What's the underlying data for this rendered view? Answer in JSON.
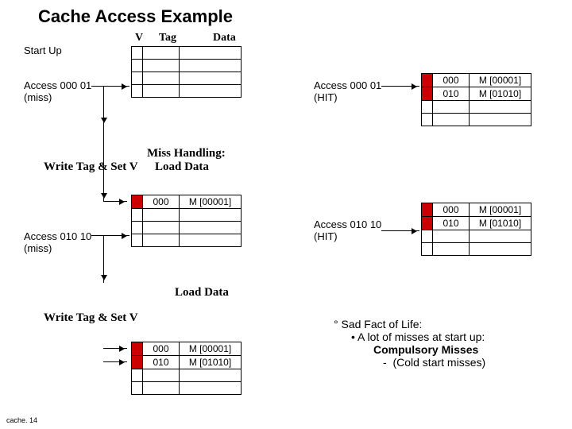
{
  "title": "Cache Access Example",
  "headers": {
    "v": "V",
    "tag": "Tag",
    "data": "Data"
  },
  "labels": {
    "startup": "Start Up",
    "access1": "Access 000 01",
    "miss": "(miss)",
    "hit": "(HIT)",
    "misshandling": "Miss Handling:",
    "writetag": "Write Tag & Set V",
    "loaddata": "Load Data",
    "access2": "Access 010 10"
  },
  "rows": {
    "r1": {
      "tag": "000",
      "data": "M [00001]"
    },
    "r2": {
      "tag": "010",
      "data": "M [01010]"
    }
  },
  "facts": {
    "h1": "Sad Fact of Life:",
    "l1": "A lot of misses at start up:",
    "l2": "Compulsory Misses",
    "l3": "(Cold start misses)"
  },
  "footer": "cache. 14",
  "chart_data": {
    "type": "table",
    "description": "Sequence of cache states for a direct-mapped cache with 4 lines, columns V (valid bit), Tag, Data.",
    "columns": [
      "V",
      "Tag",
      "Data"
    ],
    "steps": [
      {
        "label": "Start Up",
        "lines": [
          {
            "v": 0
          },
          {
            "v": 0
          },
          {
            "v": 0
          },
          {
            "v": 0
          }
        ]
      },
      {
        "label": "Access 000 01 (miss)",
        "action": "miss"
      },
      {
        "label": "Miss Handling: Write Tag & Set V / Load Data",
        "lines": [
          {
            "v": 1,
            "tag": "000",
            "data": "M [00001]"
          },
          {
            "v": 0
          },
          {
            "v": 0
          },
          {
            "v": 0
          }
        ]
      },
      {
        "label": "Access 010 10 (miss)",
        "action": "miss"
      },
      {
        "label": "Load Data / Write Tag & Set V",
        "lines": [
          {
            "v": 1,
            "tag": "000",
            "data": "M [00001]"
          },
          {
            "v": 1,
            "tag": "010",
            "data": "M [01010]"
          },
          {
            "v": 0
          },
          {
            "v": 0
          }
        ]
      },
      {
        "label": "Access 000 01 (HIT)",
        "lines": [
          {
            "v": 1,
            "tag": "000",
            "data": "M [00001]"
          },
          {
            "v": 1,
            "tag": "010",
            "data": "M [01010]"
          },
          {
            "v": 0
          },
          {
            "v": 0
          }
        ]
      },
      {
        "label": "Access 010 10 (HIT)",
        "lines": [
          {
            "v": 1,
            "tag": "000",
            "data": "M [00001]"
          },
          {
            "v": 1,
            "tag": "010",
            "data": "M [01010]"
          },
          {
            "v": 0
          },
          {
            "v": 0
          }
        ]
      }
    ]
  }
}
